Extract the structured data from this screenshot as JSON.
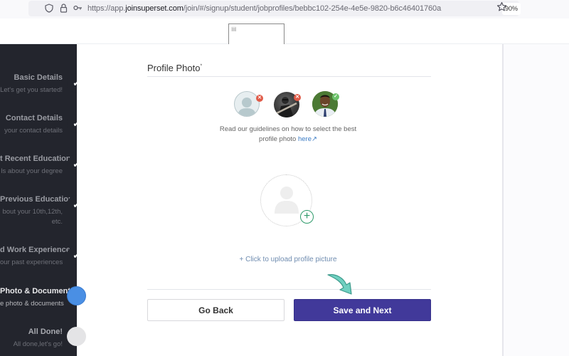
{
  "browser": {
    "url_prefix": "https://app.",
    "url_domain": "joinsuperset.com",
    "url_path": "/join/#/signup/student/jobprofiles/bebbc102-254e-4e5e-9820-b6c46401760a",
    "zoom_level": "90%",
    "icons": [
      "shield-icon",
      "lock-icon",
      "key-icon",
      "star-icon"
    ]
  },
  "sidebar": {
    "steps": [
      {
        "title": "Basic Details",
        "subtitle": "Let's get you started!",
        "status": "done"
      },
      {
        "title": "Contact Details",
        "subtitle": "your contact details",
        "status": "done"
      },
      {
        "title": "t Recent Education",
        "subtitle": "ls about your degree",
        "status": "done"
      },
      {
        "title": "Previous Education",
        "subtitle": "bout your 10th,12th,",
        "subtitle2": "etc.",
        "status": "done"
      },
      {
        "title": "d Work Experience",
        "subtitle": "our past experiences",
        "status": "done"
      },
      {
        "title": "Photo & Documents",
        "subtitle": "e photo & documents",
        "status": "active"
      },
      {
        "title": "All Done!",
        "subtitle": "All done,let's go!",
        "status": "pending"
      }
    ],
    "check_glyph": "✔"
  },
  "main": {
    "section_title": "Profile Photo",
    "required_mark": "*",
    "samples": [
      {
        "name": "placeholder-silhouette",
        "verdict": "rejected",
        "badge": "✕"
      },
      {
        "name": "guitar-photo",
        "verdict": "rejected",
        "badge": "✕"
      },
      {
        "name": "formal-portrait",
        "verdict": "accepted",
        "badge": "✓"
      }
    ],
    "guidelines_text_line1": "Read our guidelines on how to select the best",
    "guidelines_text_line2": "profile photo ",
    "guidelines_link": "here",
    "external_link_glyph": "↗",
    "upload_plus_glyph": "+",
    "upload_label": "+ Click to upload profile picture",
    "buttons": {
      "back": "Go Back",
      "next": "Save and Next"
    }
  },
  "colors": {
    "sidebar_bg": "#23252d",
    "active_step": "#4a8fe4",
    "primary_button": "#41399a",
    "upload_accent": "#2e9a6a",
    "link": "#3b7bc4",
    "reject_badge": "#e05a47",
    "accept_badge": "#6cc26a",
    "arrow_annotation": "#6fd0c0"
  }
}
